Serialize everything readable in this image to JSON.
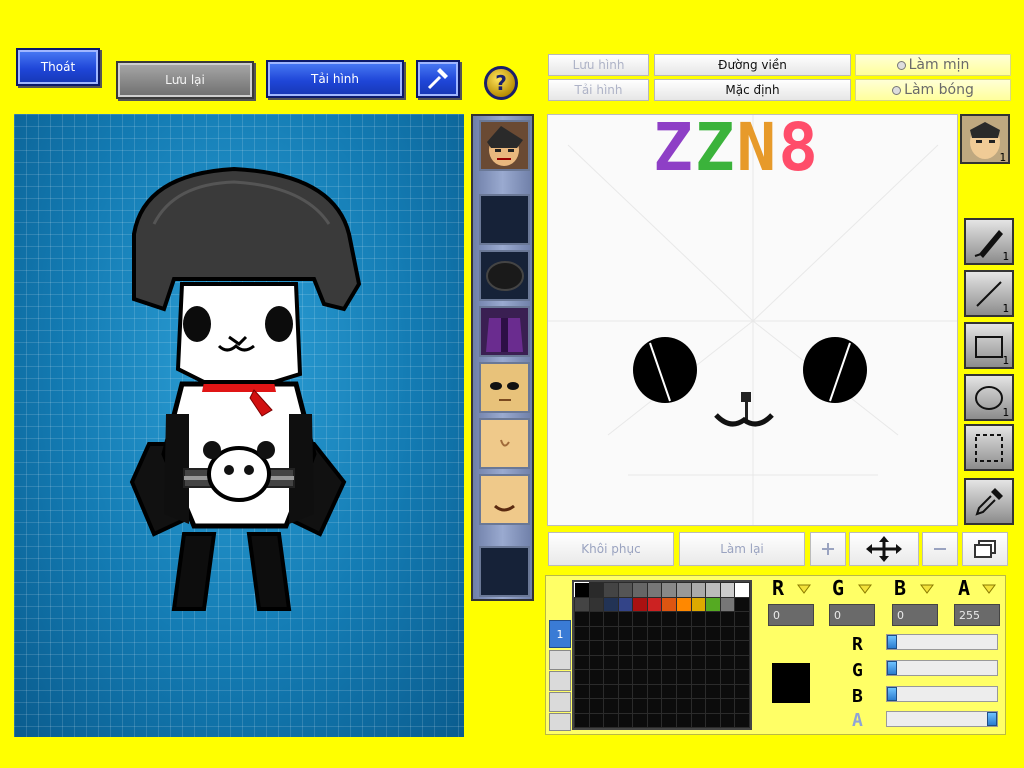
{
  "top_buttons": {
    "exit": "Thoát",
    "save": "Lưu lại",
    "reload": "Tải hình",
    "help": "?"
  },
  "right_tabs": {
    "save_image": "Lưu hình",
    "load_image": "Tải hình",
    "outline": "Đường viền",
    "default": "Mặc định",
    "smooth": "Làm mịn",
    "shiny": "Làm bóng"
  },
  "canvas_text": "ZZN8",
  "tools": [
    {
      "name": "brush",
      "count": "1"
    },
    {
      "name": "line",
      "count": "1"
    },
    {
      "name": "rectangle",
      "count": "1"
    },
    {
      "name": "ellipse",
      "count": "1"
    },
    {
      "name": "selection",
      "count": ""
    },
    {
      "name": "eyedropper",
      "count": ""
    }
  ],
  "part_count": "1",
  "bottom_toolbar": {
    "restore": "Khôi phục",
    "redo": "Làm lại"
  },
  "color_panel": {
    "page_tab": "1",
    "channels": [
      {
        "label": "R",
        "value": "0"
      },
      {
        "label": "G",
        "value": "0"
      },
      {
        "label": "B",
        "value": "0"
      },
      {
        "label": "A",
        "value": "255"
      }
    ],
    "slider_labels": [
      "R",
      "G",
      "B",
      "A"
    ],
    "slider_levels": [
      0,
      0,
      0,
      1
    ],
    "current_color": "#000000",
    "palette": [
      "#000000",
      "#2a2a2a",
      "#444444",
      "#555555",
      "#666666",
      "#777777",
      "#888888",
      "#999999",
      "#aaaaaa",
      "#bbbbbb",
      "#cccccc",
      "#ffffff",
      "#444444",
      "#333333",
      "#223355",
      "#334488",
      "#aa1111",
      "#cc2222",
      "#dd5511",
      "#ff8800",
      "#ddaa00",
      "#55aa22",
      "#777777"
    ]
  },
  "colors": {
    "background": "#ffff00",
    "accent_blue": "#1f46d8"
  }
}
